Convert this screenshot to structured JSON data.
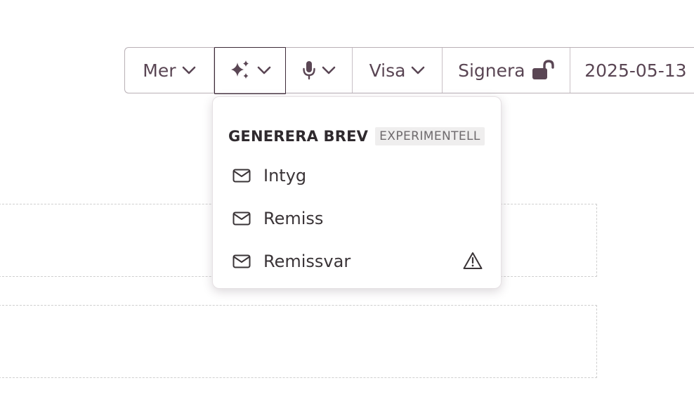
{
  "toolbar": {
    "mer_label": "Mer",
    "ai_icon": "sparkles-icon",
    "mic_icon": "microphone-icon",
    "visa_label": "Visa",
    "signera_label": "Signera",
    "signera_icon": "unlock-icon",
    "date_label": "2025-05-13"
  },
  "menu": {
    "title": "GENERERA BREV",
    "badge": "EXPERIMENTELL",
    "items": [
      {
        "label": "Intyg",
        "icon": "envelope-icon",
        "warning": false
      },
      {
        "label": "Remiss",
        "icon": "envelope-icon",
        "warning": false
      },
      {
        "label": "Remissvar",
        "icon": "envelope-icon",
        "warning": true,
        "warning_icon": "warning-triangle-icon"
      }
    ]
  },
  "colors": {
    "text": "#5a4654",
    "border": "#b9b0b6",
    "active_border": "#3d2a38",
    "dashed": "#cfcfcf"
  }
}
